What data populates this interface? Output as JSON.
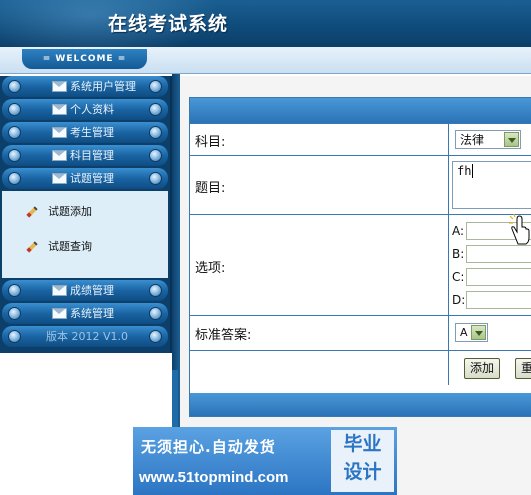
{
  "header": {
    "title": "在线考试系统",
    "welcome": "= WELCOME ="
  },
  "sidebar": {
    "items": [
      {
        "label": "系统用户管理",
        "icon": "mail-icon"
      },
      {
        "label": "个人资料",
        "icon": "mail-icon"
      },
      {
        "label": "考生管理",
        "icon": "mail-icon"
      },
      {
        "label": "科目管理",
        "icon": "mail-icon"
      },
      {
        "label": "试题管理",
        "icon": "mail-icon"
      }
    ],
    "submenu": [
      {
        "label": "试题添加",
        "icon": "pencil-icon"
      },
      {
        "label": "试题查询",
        "icon": "pencil-icon"
      }
    ],
    "items_after": [
      {
        "label": "成绩管理",
        "icon": "mail-icon"
      },
      {
        "label": "系统管理",
        "icon": "mail-icon"
      }
    ],
    "version": "版本 2012 V1.0"
  },
  "form": {
    "subject_label": "科目:",
    "subject_value": "法律",
    "question_label": "题目:",
    "question_value": "fh",
    "options_label": "选项:",
    "options": [
      {
        "letter": "A:",
        "value": ""
      },
      {
        "letter": "B:",
        "value": ""
      },
      {
        "letter": "C:",
        "value": ""
      },
      {
        "letter": "D:",
        "value": ""
      }
    ],
    "answer_label": "标准答案:",
    "answer_value": "A",
    "add_button": "添加",
    "reset_button": "重"
  },
  "watermark": {
    "line1": "无须担心.自动发货",
    "line2": "www.51topmind.com",
    "badge_top": "毕业",
    "badge_bottom": "设计"
  },
  "colors": {
    "header": "#0f4c7c",
    "panel_header": "#2a73b6",
    "menu": "#1a64a3"
  }
}
